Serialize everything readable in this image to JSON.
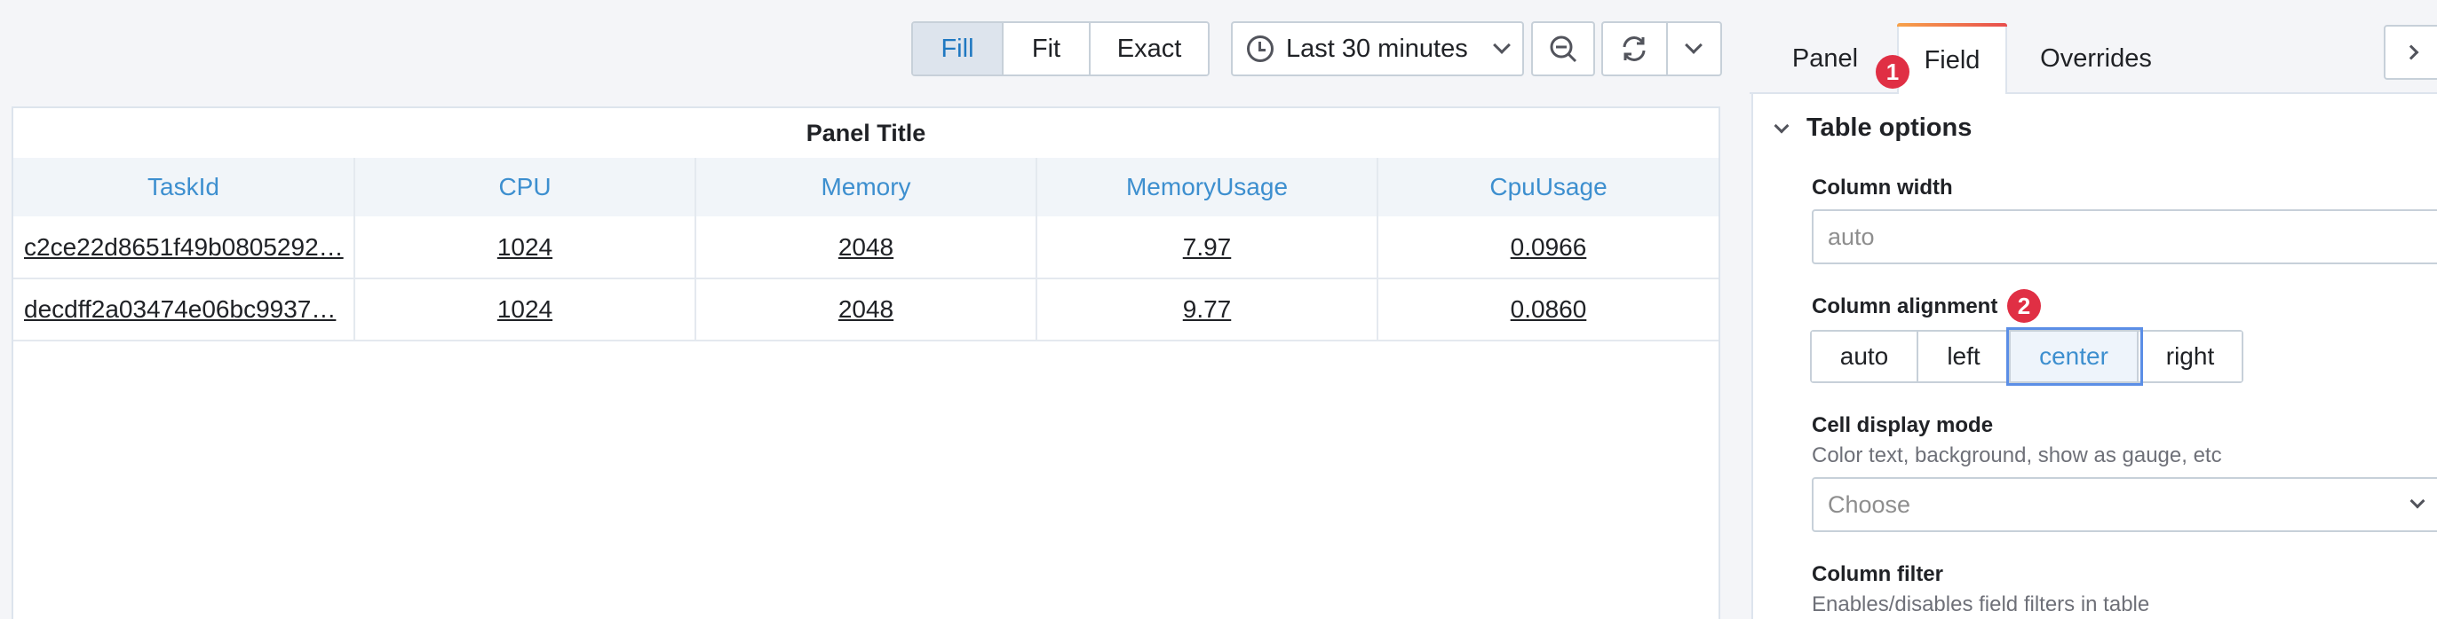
{
  "toolbar": {
    "zoom_modes": [
      "Fill",
      "Fit",
      "Exact"
    ],
    "active_zoom_mode": "Fill",
    "time_range": "Last 30 minutes"
  },
  "panel": {
    "title": "Panel Title",
    "columns": [
      "TaskId",
      "CPU",
      "Memory",
      "MemoryUsage",
      "CpuUsage"
    ],
    "rows": [
      [
        "c2ce22d8651f49b0805292…",
        "1024",
        "2048",
        "7.97",
        "0.0966"
      ],
      [
        "decdff2a03474e06bc9937…",
        "1024",
        "2048",
        "9.77",
        "0.0860"
      ]
    ]
  },
  "options_pane": {
    "tabs": [
      "Panel",
      "Field",
      "Overrides"
    ],
    "active_tab": "Field",
    "badges": [
      "1",
      "2"
    ],
    "section_title": "Table options",
    "column_width": {
      "label": "Column width",
      "placeholder": "auto"
    },
    "column_alignment": {
      "label": "Column alignment",
      "options": [
        "auto",
        "left",
        "center",
        "right"
      ],
      "selected": "center"
    },
    "cell_display_mode": {
      "label": "Cell display mode",
      "description": "Color text, background, show as gauge, etc",
      "placeholder": "Choose"
    },
    "column_filter": {
      "label": "Column filter",
      "description": "Enables/disables field filters in table"
    }
  },
  "colors": {
    "accent": "#3d8fcf",
    "badge": "#e02f44",
    "selected_outline": "#5b8ee6"
  },
  "icons": [
    "clock-icon",
    "chevron-down-icon",
    "zoom-out-icon",
    "refresh-icon",
    "chevron-right-icon",
    "collapse-chevron-icon"
  ]
}
